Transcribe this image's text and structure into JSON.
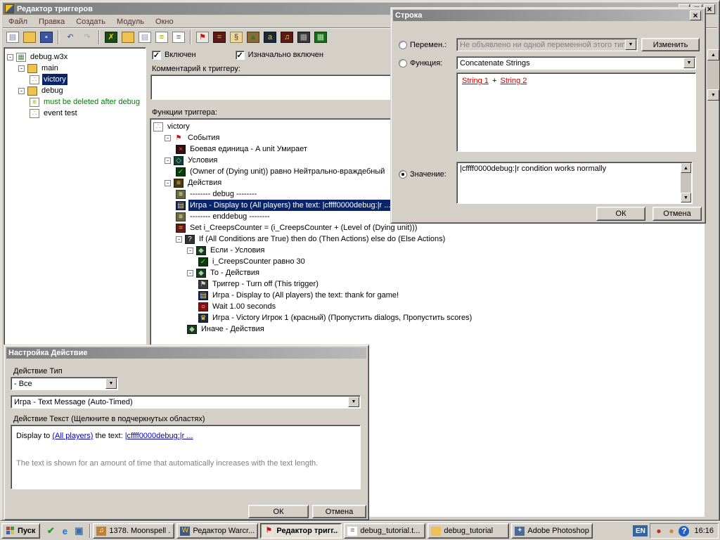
{
  "titlebar": {
    "title": "Редактор триггеров"
  },
  "menu": {
    "items": [
      {
        "name": "menu-file",
        "label": "Файл"
      },
      {
        "name": "menu-edit",
        "label": "Правка"
      },
      {
        "name": "menu-create",
        "label": "Создать"
      },
      {
        "name": "menu-module",
        "label": "Модуль"
      },
      {
        "name": "menu-window",
        "label": "Окно"
      }
    ]
  },
  "glyphs": {
    "check": "✓",
    "minus": "-"
  },
  "toolbar": {
    "icons": [
      {
        "name": "new-map-icon",
        "glyph": "▤",
        "fg": "#7a7a9a",
        "bg": "#ffffff",
        "border": "#808080"
      },
      {
        "name": "open-map-icon",
        "glyph": "",
        "fg": "#000000",
        "bg": "#f0c050",
        "border": "#8a6a10"
      },
      {
        "name": "save-map-icon",
        "glyph": "▪",
        "fg": "#d0d0e0",
        "bg": "#3a56a0",
        "border": "#1a2a60"
      },
      {
        "name": "separator"
      },
      {
        "name": "undo-icon",
        "glyph": "↶",
        "fg": "#3050c0",
        "bg": "transparent",
        "border": "transparent"
      },
      {
        "name": "redo-icon",
        "glyph": "↷",
        "fg": "#98a8c8",
        "bg": "transparent",
        "border": "transparent"
      },
      {
        "name": "separator"
      },
      {
        "name": "delete-icon",
        "glyph": "✗",
        "fg": "#f0d020",
        "bg": "#1a4a1a",
        "border": "#0a2a0a"
      },
      {
        "name": "new-category-icon",
        "glyph": "",
        "fg": "#000000",
        "bg": "#f0c050",
        "border": "#8a6a10"
      },
      {
        "name": "new-trigger-icon",
        "glyph": "▤",
        "fg": "#9090b0",
        "bg": "#ffffff",
        "border": "#808080"
      },
      {
        "name": "new-comment-icon",
        "glyph": "≡",
        "fg": "#a0a020",
        "bg": "#ffffff",
        "border": "#808080"
      },
      {
        "name": "new-script-icon",
        "glyph": "≡",
        "fg": "#606060",
        "bg": "#ffffff",
        "border": "#808080"
      },
      {
        "name": "separator"
      },
      {
        "name": "new-event-icon",
        "glyph": "⚑",
        "fg": "#cc1010",
        "bg": "#ece8e0",
        "border": "#808080"
      },
      {
        "name": "variable-editor-icon",
        "glyph": "=",
        "fg": "#f0d020",
        "bg": "#5a1a1a",
        "border": "#2a0808"
      },
      {
        "name": "script-editor-icon",
        "glyph": "§",
        "fg": "#5a3a10",
        "bg": "#e8d8a0",
        "border": "#a08040"
      },
      {
        "name": "terrain-editor-icon",
        "glyph": "▲",
        "fg": "#2a7a2a",
        "bg": "#8a6a3a",
        "border": "#4a3a1a"
      },
      {
        "name": "object-editor-icon",
        "glyph": "а",
        "fg": "#f0c020",
        "bg": "#1a2a3a",
        "border": "#0a121a"
      },
      {
        "name": "sound-editor-icon",
        "glyph": "♫",
        "fg": "#f0d040",
        "bg": "#5a1a1a",
        "border": "#2a0a0a"
      },
      {
        "name": "import-manager-icon",
        "glyph": "▦",
        "fg": "#b0b0b0",
        "bg": "#3a3a3a",
        "border": "#101010"
      },
      {
        "name": "test-map-icon",
        "glyph": "▦",
        "fg": "#b0e0b0",
        "bg": "#1a6a1a",
        "border": "#0a3a0a"
      }
    ]
  },
  "icons": {
    "map-file-icon": {
      "glyph": "▦",
      "fg": "#4a8a4a",
      "bg": "#ffffff",
      "border": "#808080"
    },
    "folder-open-icon": {
      "glyph": "",
      "fg": "#000000",
      "bg": "#f0c050",
      "border": "#8a6a10"
    },
    "trigger-file-icon": {
      "glyph": "∴",
      "fg": "#b08020",
      "bg": "#ffffff",
      "border": "#808080"
    },
    "comment-trigger-icon": {
      "glyph": "≡",
      "fg": "#90a020",
      "bg": "#ffffff",
      "border": "#808080"
    },
    "events-icon": {
      "glyph": "⚑",
      "fg": "#cc1010",
      "bg": "transparent",
      "border": "transparent"
    },
    "unit-event-icon": {
      "glyph": "×",
      "fg": "#ff5040",
      "bg": "#301010",
      "border": "#180808"
    },
    "conditions-icon": {
      "glyph": "◇",
      "fg": "#f0c040",
      "bg": "#0a4040",
      "border": "#052020"
    },
    "condition-check-icon": {
      "glyph": "✓",
      "fg": "#40e040",
      "bg": "#0a3a0a",
      "border": "#051f05"
    },
    "actions-icon": {
      "glyph": "≡",
      "fg": "#ffd040",
      "bg": "#4a3a10",
      "border": "#251d08"
    },
    "comment-action-icon": {
      "glyph": "≡",
      "fg": "#ffff90",
      "bg": "#6a6a40",
      "border": "#353520"
    },
    "display-action-icon": {
      "glyph": "▤",
      "fg": "#ffd040",
      "bg": "#102868",
      "border": "#081434"
    },
    "set-variable-icon": {
      "glyph": "=",
      "fg": "#ffd040",
      "bg": "#6a1a1a",
      "border": "#350d0d"
    },
    "if-then-else-icon": {
      "glyph": "?",
      "fg": "#ffffff",
      "bg": "#333333",
      "border": "#191919"
    },
    "branch-icon": {
      "glyph": "◆",
      "fg": "#a0d0a0",
      "bg": "#1a3a1a",
      "border": "#0d1d0d"
    },
    "trigger-off-icon": {
      "glyph": "⚑",
      "fg": "#d0d0d0",
      "bg": "#3a3a3a",
      "border": "#1d1d1d"
    },
    "wait-icon": {
      "glyph": "○",
      "fg": "#ffffff",
      "bg": "#8a1010",
      "border": "#450808"
    },
    "victory-action-icon": {
      "glyph": "♛",
      "fg": "#ffd040",
      "bg": "#1a2a4a",
      "border": "#0d1525"
    }
  },
  "map_tree": {
    "rows": [
      {
        "depth": 0,
        "expander": "minus",
        "icon": "map-file-icon",
        "label": "debug.w3x"
      },
      {
        "depth": 1,
        "expander": "minus",
        "icon": "folder-open-icon",
        "label": "main"
      },
      {
        "depth": 2,
        "expander": "none",
        "icon": "trigger-file-icon",
        "label": "victory",
        "selected": true
      },
      {
        "depth": 1,
        "expander": "minus",
        "icon": "folder-open-icon",
        "label": "debug"
      },
      {
        "depth": 2,
        "expander": "none",
        "icon": "comment-trigger-icon",
        "label": "must be deleted after debug",
        "color": "#008000"
      },
      {
        "depth": 2,
        "expander": "none",
        "icon": "trigger-file-icon",
        "label": "event test"
      }
    ]
  },
  "trigger_panel": {
    "enabled_label": "Включен",
    "enabled_checked": true,
    "initially_on_label": "Изначально включен",
    "initially_on_checked": true,
    "comment_label": "Комментарий к триггеру:",
    "comment_value": "",
    "functions_label": "Функции триггера:",
    "rows": [
      {
        "depth": 0,
        "expander": "none",
        "icon": "trigger-file-icon",
        "label": "victory"
      },
      {
        "depth": 1,
        "expander": "minus",
        "icon": "events-icon",
        "label": "События"
      },
      {
        "depth": 2,
        "expander": "none",
        "icon": "unit-event-icon",
        "label": "Боевая единица - A unit Умирает"
      },
      {
        "depth": 1,
        "expander": "minus",
        "icon": "conditions-icon",
        "label": "Условия"
      },
      {
        "depth": 2,
        "expander": "none",
        "icon": "condition-check-icon",
        "label": "(Owner of (Dying unit)) равно Нейтрально-враждебный"
      },
      {
        "depth": 1,
        "expander": "minus",
        "icon": "actions-icon",
        "label": "Действия"
      },
      {
        "depth": 2,
        "expander": "none",
        "icon": "comment-action-icon",
        "label": "-------- debug --------"
      },
      {
        "depth": 2,
        "expander": "none",
        "icon": "display-action-icon",
        "label": "Игра - Display to (All players) the text: |cffff0000debug:|r ...",
        "selected": true
      },
      {
        "depth": 2,
        "expander": "none",
        "icon": "comment-action-icon",
        "label": "-------- enddebug --------"
      },
      {
        "depth": 2,
        "expander": "none",
        "icon": "set-variable-icon",
        "label": "Set i_CreepsCounter = (i_CreepsCounter + (Level of (Dying unit)))"
      },
      {
        "depth": 2,
        "expander": "minus",
        "icon": "if-then-else-icon",
        "label": "If (All Conditions are True) then do (Then Actions) else do (Else Actions)"
      },
      {
        "depth": 3,
        "expander": "minus",
        "icon": "branch-icon",
        "label": "Если - Условия"
      },
      {
        "depth": 4,
        "expander": "none",
        "icon": "condition-check-icon",
        "label": "i_CreepsCounter равно 30"
      },
      {
        "depth": 3,
        "expander": "minus",
        "icon": "branch-icon",
        "label": "То - Действия"
      },
      {
        "depth": 4,
        "expander": "none",
        "icon": "trigger-off-icon",
        "label": "Триггер - Turn off (This trigger)"
      },
      {
        "depth": 4,
        "expander": "none",
        "icon": "display-action-icon",
        "label": "Игра - Display to (All players) the text: thank for game!"
      },
      {
        "depth": 4,
        "expander": "none",
        "icon": "wait-icon",
        "label": "Wait 1.00 seconds"
      },
      {
        "depth": 4,
        "expander": "none",
        "icon": "victory-action-icon",
        "label": "Игра - Victory Игрок 1 (красный) (Пропустить dialogs, Пропустить scores)"
      },
      {
        "depth": 3,
        "expander": "none",
        "icon": "branch-icon",
        "label": "Иначе - Действия"
      }
    ]
  },
  "string_dialog": {
    "title": "Строка",
    "variable_selected": false,
    "variable_label": "Перемен.:",
    "variable_value": "Не объявлено ни одной переменной этого тип",
    "edit_button": "Изменить",
    "function_selected": false,
    "function_label": "Функция:",
    "function_value": "Concatenate Strings",
    "param1": "String 1",
    "param_sep": "+",
    "param2": "String 2",
    "value_selected": true,
    "value_label": "Значение:",
    "value_text": "|cffff0000debug:|r condition works normally",
    "ok": "ОК",
    "cancel": "Отмена"
  },
  "action_dialog": {
    "title": "Настройка Действие",
    "type_label": "Действие Тип",
    "type_value": "- Все",
    "action_value": "Игра - Text Message (Auto-Timed)",
    "text_label": "Действие Текст (Щелкните в подчеркнутых областях)",
    "text_prefix": "Display to",
    "text_link1": "(All players)",
    "text_mid": "the text:",
    "text_link2": "|cffff0000debug:|r ...",
    "description": "The text is shown for an amount of time that automatically increases with the text length.",
    "ok": "ОК",
    "cancel": "Отмена"
  },
  "taskbar": {
    "start": "Пуск",
    "quick_launch": [
      {
        "name": "quick-launch-v-icon",
        "glyph": "✔",
        "fg": "#20a020"
      },
      {
        "name": "quick-launch-ie-icon",
        "glyph": "e",
        "fg": "#2070d0"
      },
      {
        "name": "quick-launch-desktop-icon",
        "glyph": "▣",
        "fg": "#3a6ea5"
      }
    ],
    "tasks": [
      {
        "name": "task-moonspell",
        "label": "1378. Moonspell ...",
        "glyph": "♫",
        "fg": "#ffffff",
        "bg": "#c08030"
      },
      {
        "name": "task-warcraft-editor",
        "label": "Редактор Warcr...",
        "glyph": "W",
        "fg": "#ffd040",
        "bg": "#3a5a8a"
      },
      {
        "name": "task-trigger-editor",
        "label": "Редактор тригг...",
        "glyph": "⚑",
        "fg": "#cc1010",
        "bg": "#e8e4dc",
        "active": true
      },
      {
        "name": "task-debug-tutorial-txt",
        "label": "debug_tutorial.t...",
        "glyph": "≡",
        "fg": "#4060a0",
        "bg": "#ffffff"
      },
      {
        "name": "task-debug-tutorial-folder",
        "label": "debug_tutorial",
        "glyph": "",
        "fg": "#000000",
        "bg": "#f0c050"
      },
      {
        "name": "task-adobe-photoshop",
        "label": "Adobe Photoshop",
        "glyph": "✦",
        "fg": "#cfe2f3",
        "bg": "#4a6a9a"
      }
    ],
    "lang": "EN",
    "time": "16:16",
    "tray": [
      {
        "name": "tray-icon-red",
        "glyph": "●",
        "fg": "#d02020"
      },
      {
        "name": "tray-icon-orange",
        "glyph": "●",
        "fg": "#e08020"
      },
      {
        "name": "tray-help-icon",
        "glyph": "?",
        "fg": "#ffffff",
        "bg": "#2060c0"
      }
    ]
  }
}
